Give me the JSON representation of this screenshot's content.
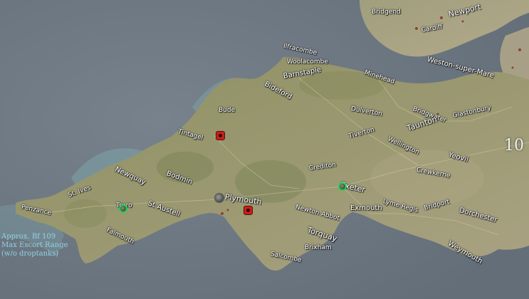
{
  "places": {
    "bridgend": "Bridgend",
    "cardiff": "Cardiff",
    "newport": "Newport",
    "ilfracombe": "Ilfracombe",
    "woolacombe": "Woolacombe",
    "barnstaple": "Barnstaple",
    "bideford": "Bideford",
    "minehead": "Minehead",
    "weston": "Weston-super-Mare",
    "bude": "Bude",
    "dulverton": "Dulverton",
    "bridgwater": "Bridgwater",
    "glastonbury": "Glastonbury",
    "tintagel": "Tintagel",
    "taunton": "Taunton",
    "tiverton": "Tiverton",
    "wellington": "Wellington",
    "yeovil": "Yeovil",
    "newquay": "Newquay",
    "bodmin": "Bodmin",
    "crediton": "Crediton",
    "crewkerne": "Crewkerne",
    "exeter": "Exeter",
    "st_ives": "St. Ives",
    "plymouth": "Plymouth",
    "penzance": "Penzance",
    "truro": "Truro",
    "st_austell": "St Austell",
    "lyme_regis": "Lyme Regis",
    "bridport": "Bridport",
    "dorchester": "Dorchester",
    "newton_abbot": "Newton Abbot",
    "exmouth": "Exmouth",
    "falmouth": "Falmouth",
    "torquay": "Torquay",
    "brixham": "Brixham",
    "salcombe": "Salcombe",
    "weymouth": "Weymouth",
    "big_number": "10"
  },
  "range_note": {
    "line1": "Approx. Bf 109",
    "line2": "Max Escort Range",
    "line3": "(w/o droptanks)"
  },
  "colors": {
    "sea": "#6b7580",
    "land": "#8c8f62",
    "airfield_friendly_ring": "#19d64a",
    "airfield_enemy": "#c8201c",
    "range_text": "#8fd3e6"
  }
}
